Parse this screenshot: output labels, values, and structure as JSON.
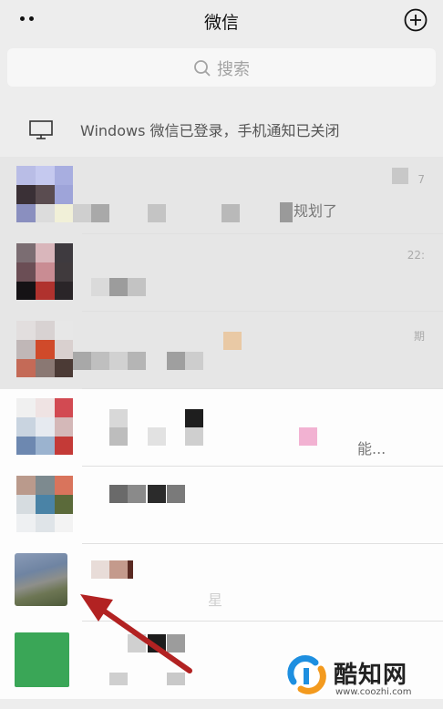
{
  "header": {
    "title": "微信",
    "more_icon": "more-dots-icon",
    "add_icon": "plus-circle-icon"
  },
  "search": {
    "placeholder": "搜索",
    "icon": "search-icon"
  },
  "notice": {
    "text": "Windows 微信已登录，手机通知已关闭",
    "icon": "desktop-monitor-icon"
  },
  "chats": [
    {
      "snippet": "规划了",
      "time": "7"
    },
    {
      "snippet": "",
      "time": "22:"
    },
    {
      "snippet": "",
      "time": "期"
    },
    {
      "snippet": "能...",
      "time": ""
    },
    {
      "snippet": "",
      "time": ""
    },
    {
      "snippet": "星",
      "time": ""
    },
    {
      "snippet": "",
      "time": ""
    }
  ],
  "watermark": {
    "name": "酷知网",
    "url": "www.coozhi.com"
  },
  "colors": {
    "arrow": "#b22222",
    "brand_blue": "#1e8fe0",
    "brand_orange": "#f39a1e"
  }
}
